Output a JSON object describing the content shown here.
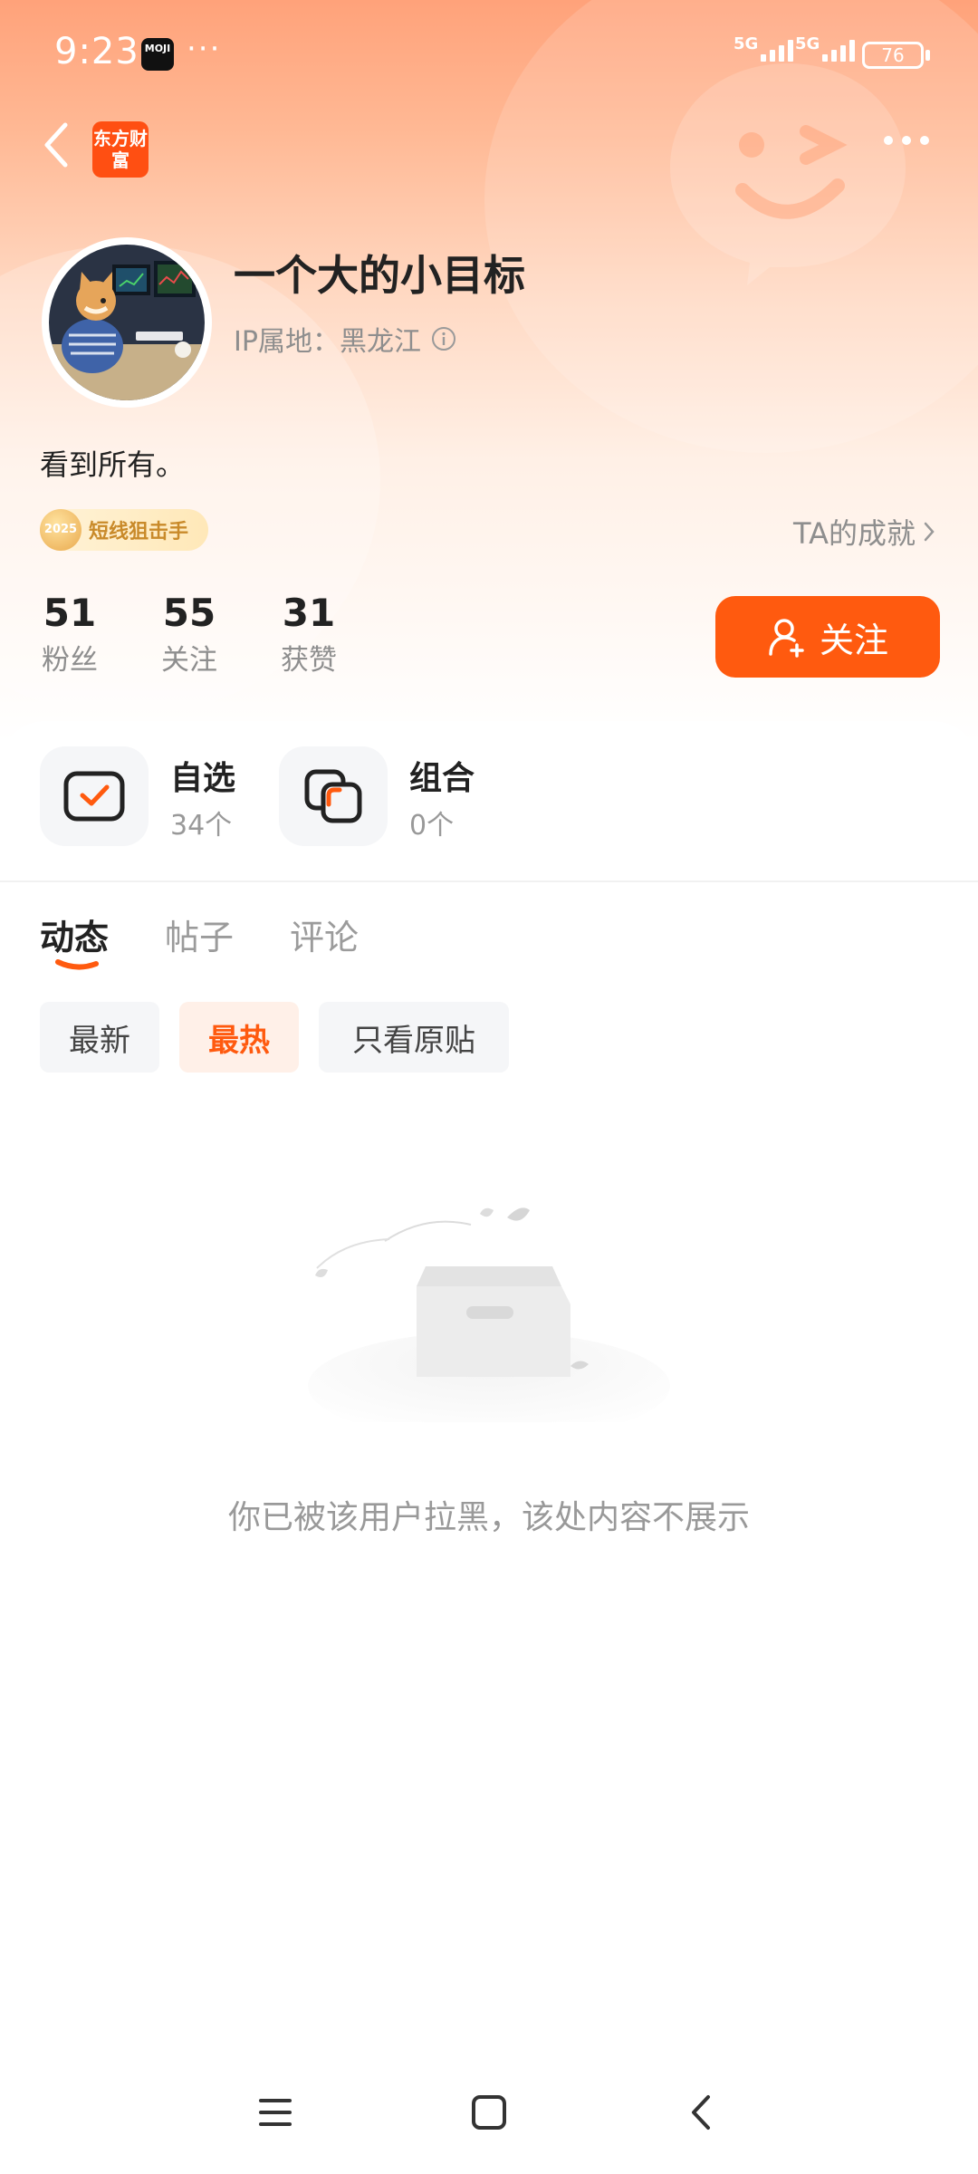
{
  "status_bar": {
    "time": "9:23",
    "app_badge": "MOJI",
    "dots": "···",
    "signal1": "5G",
    "signal2": "5G",
    "battery": "76"
  },
  "header": {
    "logo_text": "东方财富"
  },
  "profile": {
    "name": "一个大的小目标",
    "ip_label": "IP属地：黑龙江",
    "bio": "看到所有。",
    "badge_year": "2025",
    "badge_label": "短线狙击手",
    "achievements_link": "TA的成就"
  },
  "stats": [
    {
      "value": "51",
      "label": "粉丝"
    },
    {
      "value": "55",
      "label": "关注"
    },
    {
      "value": "31",
      "label": "获赞"
    }
  ],
  "follow_button": "关注",
  "quick_links": [
    {
      "title": "自选",
      "subtitle": "34个"
    },
    {
      "title": "组合",
      "subtitle": "0个"
    }
  ],
  "tabs": [
    {
      "label": "动态",
      "active": true
    },
    {
      "label": "帖子",
      "active": false
    },
    {
      "label": "评论",
      "active": false
    }
  ],
  "filters": [
    {
      "label": "最新",
      "active": false
    },
    {
      "label": "最热",
      "active": true
    },
    {
      "label": "只看原贴",
      "active": false
    }
  ],
  "empty_state": {
    "message": "你已被该用户拉黑，该处内容不展示"
  },
  "colors": {
    "accent": "#ff5a0f",
    "hero_top": "#ffa27a",
    "muted_text": "#8e8e8e"
  },
  "icons": {
    "back": "chevron-left-icon",
    "more": "more-dots-icon",
    "info": "info-icon",
    "follow": "add-user-icon",
    "watchlist": "watchlist-check-icon",
    "portfolio": "portfolio-squares-icon"
  }
}
